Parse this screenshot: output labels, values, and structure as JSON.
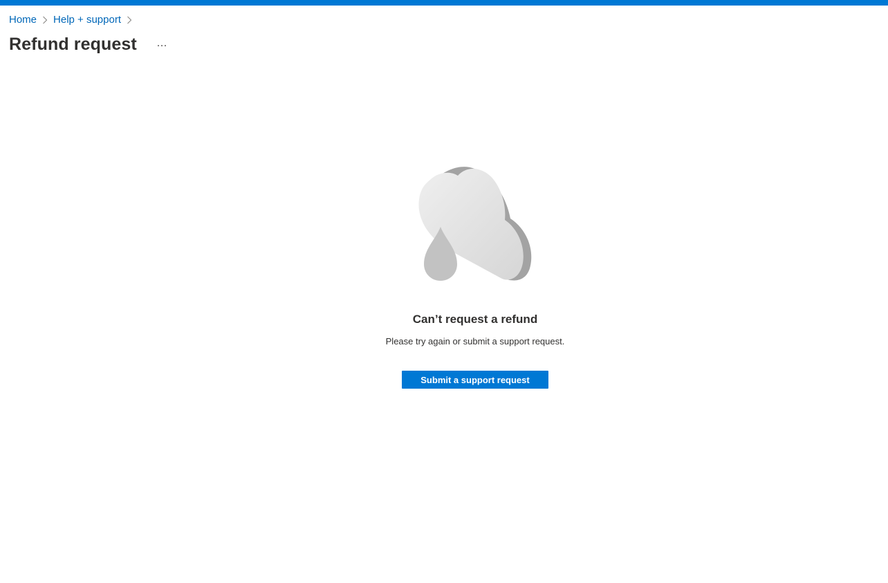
{
  "breadcrumb": {
    "items": [
      {
        "label": "Home"
      },
      {
        "label": "Help + support"
      }
    ],
    "separator_icon": "chevron-right-icon"
  },
  "header": {
    "title": "Refund request",
    "more_icon": "more-ellipsis-icon"
  },
  "empty_state": {
    "illustration_icon": "cloud-raindrop-icon",
    "title": "Can’t request a refund",
    "message": "Please try again or submit a support request.",
    "button_label": "Submit a support request"
  },
  "colors": {
    "accent": "#0078d4",
    "link": "#0067b8",
    "text": "#323130"
  }
}
